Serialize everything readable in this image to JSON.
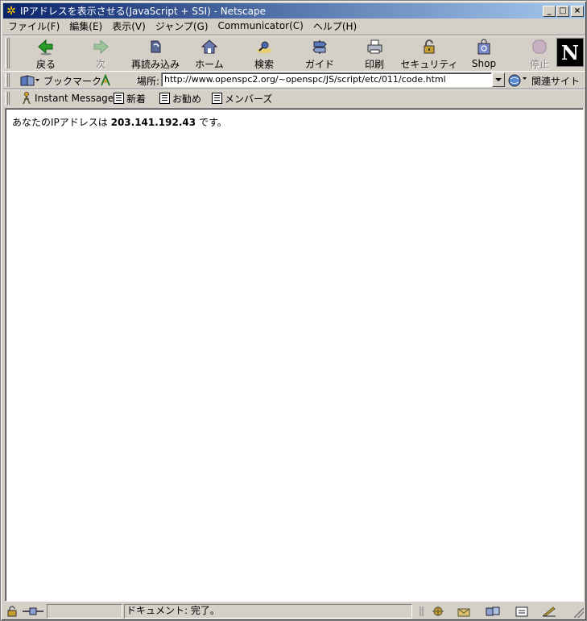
{
  "window": {
    "title": "IPアドレスを表示させる(JavaScript + SSI) - Netscape",
    "minimize": "_",
    "maximize": "□",
    "close": "×"
  },
  "menu": [
    "ファイル(F)",
    "編集(E)",
    "表示(V)",
    "ジャンプ(G)",
    "Communicator(C)",
    "ヘルプ(H)"
  ],
  "nav": {
    "back": "戻る",
    "forward": "次",
    "reload": "再読み込み",
    "home": "ホーム",
    "search": "検索",
    "guide": "ガイド",
    "print": "印刷",
    "security": "セキュリティ",
    "shop": "Shop",
    "stop": "停止",
    "logo": "N"
  },
  "location": {
    "bookmarks_label": "ブックマーク",
    "location_label": "場所:",
    "url": "http://www.openspc2.org/~openspc/JS/script/etc/011/code.html",
    "related_label": "関連サイト"
  },
  "personal": {
    "instant_message": "Instant Message",
    "new": "新着",
    "recommend": "お勧め",
    "members": "メンバーズ"
  },
  "content": {
    "prefix": "あなたのIPアドレスは ",
    "ip": "203.141.192.43",
    "suffix": " です。"
  },
  "status": {
    "text": "ドキュメント: 完了。"
  }
}
